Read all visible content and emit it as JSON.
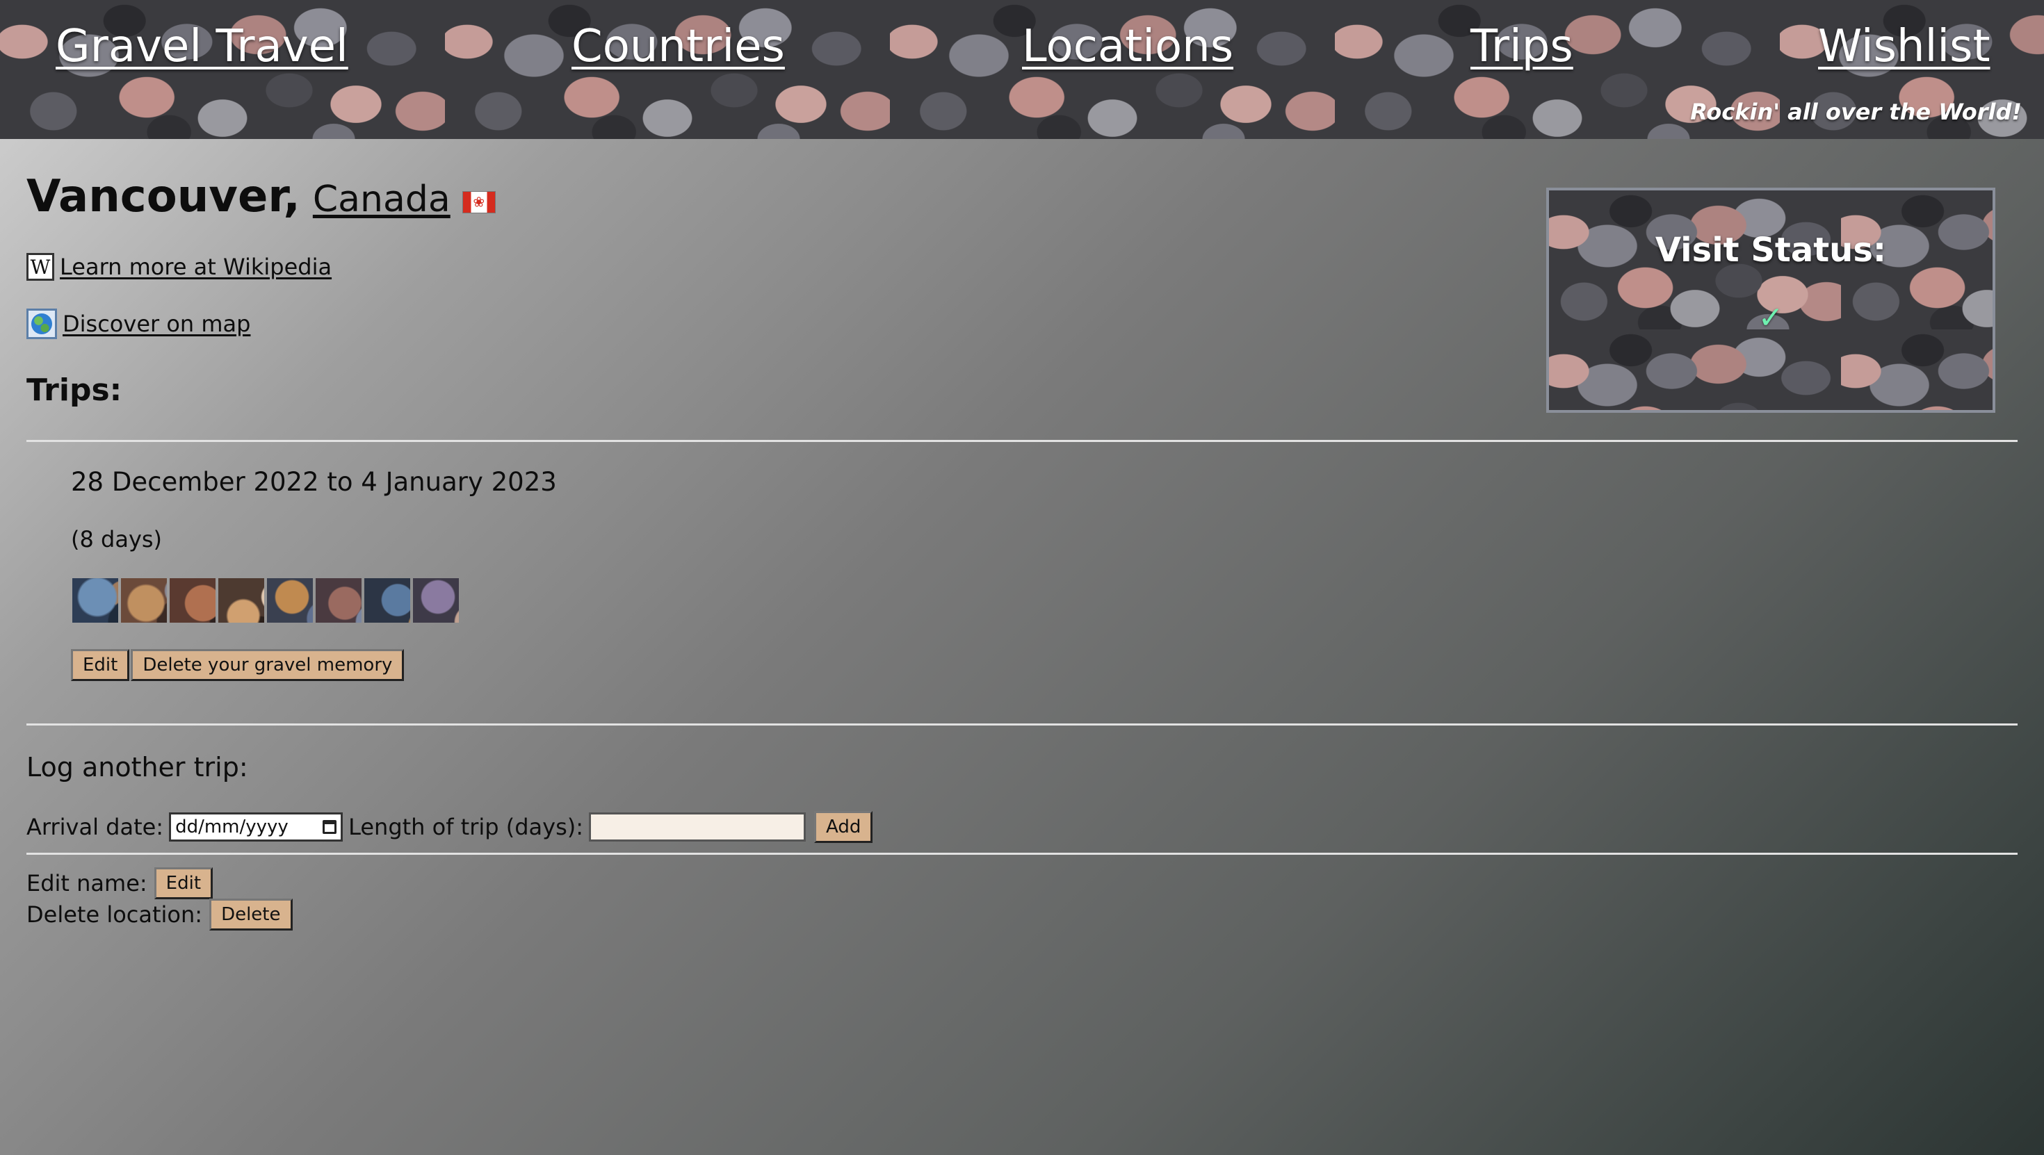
{
  "header": {
    "nav": {
      "home": "Gravel Travel",
      "countries": "Countries",
      "locations": "Locations",
      "trips": "Trips",
      "wishlist": "Wishlist"
    },
    "tagline": "Rockin' all over the World!"
  },
  "location": {
    "city": "Vancouver,",
    "country": "Canada",
    "flag_icon": "canada-flag-icon"
  },
  "links": {
    "wikipedia": "Learn more at Wikipedia",
    "map": "Discover on map",
    "wikipedia_icon_glyph": "W"
  },
  "trips": {
    "heading": "Trips:",
    "items": [
      {
        "dates": "28 December 2022 to 4 January 2023",
        "length": "(8 days)",
        "thumbnail_count": 8,
        "edit_label": "Edit",
        "delete_label": "Delete your gravel memory"
      }
    ]
  },
  "log_trip": {
    "heading": "Log another trip:",
    "arrival_label": "Arrival date:",
    "arrival_placeholder": "dd/mm/yyyy",
    "length_label": "Length of trip (days):",
    "length_value": "",
    "add_label": "Add"
  },
  "manage": {
    "edit_name_label": "Edit name:",
    "edit_button": "Edit",
    "delete_location_label": "Delete location:",
    "delete_button": "Delete"
  },
  "visit_status": {
    "title": "Visit Status:",
    "check": "✓"
  }
}
